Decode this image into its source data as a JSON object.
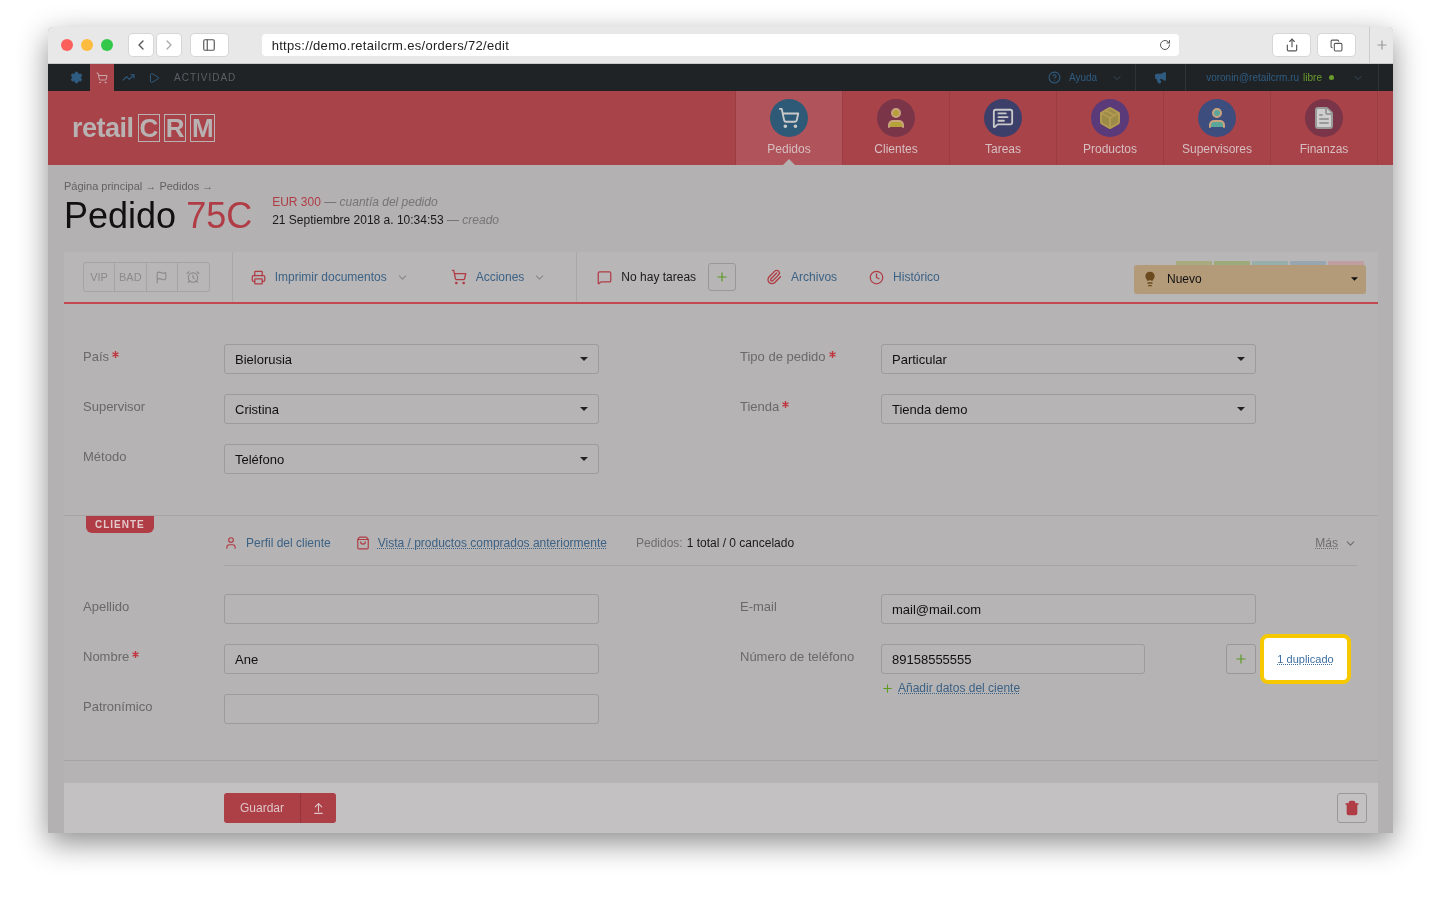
{
  "browser": {
    "url": "https://demo.retailcrm.es/orders/72/edit"
  },
  "top_bar": {
    "section": "ACTIVIDAD",
    "help": "Ayuda",
    "user": "voronin@retailcrm.ru",
    "status": "libre"
  },
  "logo": {
    "word": "retail",
    "letters": [
      "C",
      "R",
      "M"
    ]
  },
  "nav": [
    {
      "label": "Pedidos",
      "selected": true
    },
    {
      "label": "Clientes",
      "selected": false
    },
    {
      "label": "Tareas",
      "selected": false
    },
    {
      "label": "Productos",
      "selected": false
    },
    {
      "label": "Supervisores",
      "selected": false
    },
    {
      "label": "Finanzas",
      "selected": false
    }
  ],
  "breadcrumb": "Página principal → Pedidos →",
  "title": {
    "prefix": "Pedido",
    "number": "75C"
  },
  "summary": {
    "amount": "EUR 300",
    "amount_note": "— cuantía del pedido",
    "created": "21 Septiembre 2018 a. 10:34:53",
    "created_note": "— creado"
  },
  "toolbar": {
    "tags": [
      "VIP",
      "BAD"
    ],
    "print": "Imprimir documentos",
    "actions": "Acciones",
    "tasks": "No hay tareas",
    "files": "Archivos",
    "history": "Histórico",
    "status": "Nuevo"
  },
  "order_fields": {
    "left": [
      {
        "label": "País",
        "required": true,
        "value": "Bielorusia"
      },
      {
        "label": "Supervisor",
        "required": false,
        "value": "Cristina"
      },
      {
        "label": "Método",
        "required": false,
        "value": "Teléfono"
      }
    ],
    "right": [
      {
        "label": "Tipo de pedido",
        "required": true,
        "value": "Particular"
      },
      {
        "label": "Tienda",
        "required": true,
        "value": "Tienda demo"
      }
    ]
  },
  "client": {
    "tag": "CLIENTE",
    "profile": "Perfil del cliente",
    "history": "Vista / productos comprados anteriormente",
    "orders_label": "Pedidos:",
    "orders_value": "1 total / 0 cancelado",
    "more": "Más",
    "left": [
      {
        "label": "Apellido",
        "required": false
      },
      {
        "label": "Nombre",
        "required": true,
        "value": "Ane"
      },
      {
        "label": "Patronímico",
        "required": false
      }
    ],
    "right": [
      {
        "label": "E-mail",
        "required": false,
        "value": "mail@mail.com"
      },
      {
        "label": "Número de teléfono",
        "required": false,
        "value": "89158555555"
      }
    ],
    "add_data": "Añadir datos del ciente",
    "duplicate": "1 duplicado"
  },
  "footer": {
    "save": "Guardar"
  }
}
